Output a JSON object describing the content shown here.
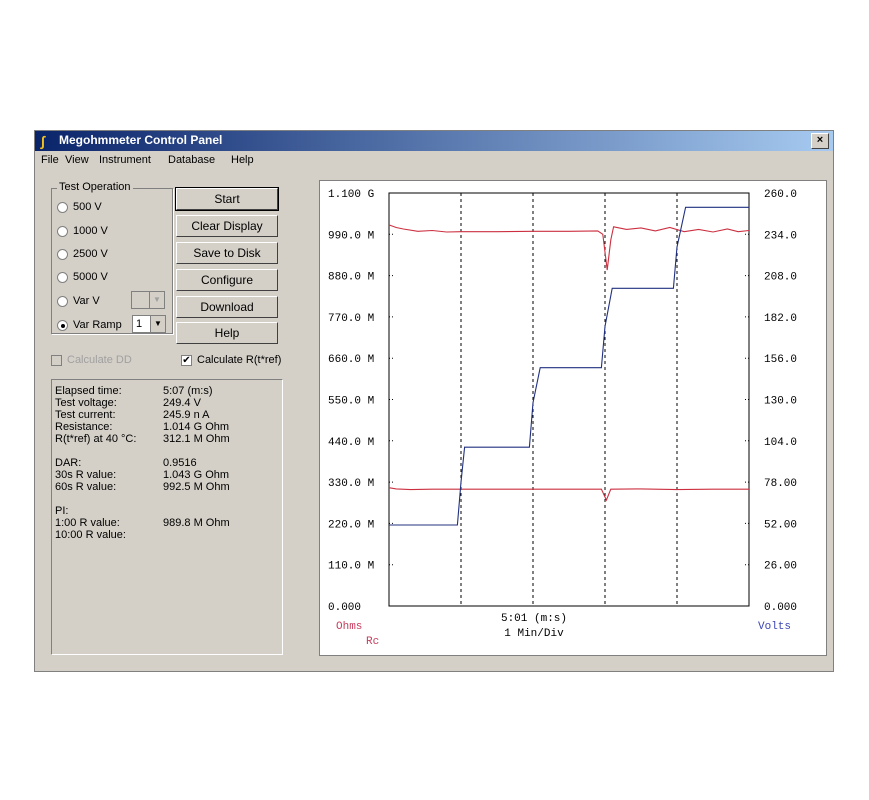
{
  "window": {
    "title": "Megohmmeter Control Panel",
    "close_label": "×"
  },
  "menu": [
    "File",
    "View",
    "Instrument",
    "Database",
    "Help"
  ],
  "test_operation": {
    "label": "Test Operation",
    "options": [
      "500 V",
      "1000 V",
      "2500 V",
      "5000 V",
      "Var V",
      "Var Ramp"
    ],
    "selected": "Var Ramp",
    "var_ramp_value": "1"
  },
  "buttons": [
    "Start",
    "Clear Display",
    "Save to Disk",
    "Configure",
    "Download",
    "Help"
  ],
  "checks": {
    "calc_dd": {
      "label": "Calculate DD",
      "checked": false,
      "enabled": false
    },
    "calc_r": {
      "label": "Calculate R(t*ref)",
      "checked": true,
      "enabled": true
    }
  },
  "status": [
    {
      "label": "Elapsed time:",
      "value": "5:07 (m:s)"
    },
    {
      "label": "Test voltage:",
      "value": "249.4  V"
    },
    {
      "label": "Test current:",
      "value": "245.9 n A"
    },
    {
      "label": "Resistance:",
      "value": "1.014 G Ohm"
    },
    {
      "label": "R(t*ref) at 40 °C:",
      "value": "312.1 M Ohm"
    },
    {
      "label": "",
      "value": ""
    },
    {
      "label": "DAR:",
      "value": "0.9516"
    },
    {
      "label": "30s R value:",
      "value": "1.043 G Ohm"
    },
    {
      "label": "60s R value:",
      "value": "992.5 M Ohm"
    },
    {
      "label": "",
      "value": ""
    },
    {
      "label": "PI:",
      "value": ""
    },
    {
      "label": "1:00 R value:",
      "value": "989.8 M Ohm"
    },
    {
      "label": "10:00 R value:",
      "value": ""
    }
  ],
  "chart_data": {
    "type": "line",
    "x_center_label": "5:01 (m:s)",
    "x_div_label": "1 Min/Div",
    "left_axis_label": "Ohms",
    "left_axis_sublabel": "Rc",
    "right_axis_label": "Volts",
    "left_ticks": [
      "1.100 G",
      "990.0 M",
      "880.0 M",
      "770.0 M",
      "660.0 M",
      "550.0 M",
      "440.0 M",
      "330.0 M",
      "220.0 M",
      "110.0 M",
      "0.000"
    ],
    "right_ticks": [
      "260.0",
      "234.0",
      "208.0",
      "182.0",
      "156.0",
      "130.0",
      "104.0",
      "78.00",
      "52.00",
      "26.00",
      "0.000"
    ],
    "left_range": [
      0,
      1100000000
    ],
    "right_range": [
      0,
      260
    ],
    "x_range": [
      0,
      5
    ],
    "vertical_grid_x": [
      1,
      2,
      3,
      4
    ],
    "colors": {
      "resistance": "#cc3040",
      "rc": "#cc3040",
      "voltage": "#203080",
      "left_label": "#c83c5c",
      "right_label": "#3c46b4"
    },
    "series": [
      {
        "name": "Ohms",
        "points": [
          [
            0,
            1015000000
          ],
          [
            0.1,
            1008000000
          ],
          [
            0.2,
            1004000000
          ],
          [
            0.4,
            998000000
          ],
          [
            0.6,
            1000000000
          ],
          [
            0.8,
            996000000
          ],
          [
            1.0,
            997000000
          ],
          [
            1.5,
            997000000
          ],
          [
            2.0,
            998000000
          ],
          [
            2.5,
            998000000
          ],
          [
            2.9,
            999000000
          ],
          [
            2.97,
            990000000
          ],
          [
            3.03,
            895000000
          ],
          [
            3.08,
            975000000
          ],
          [
            3.12,
            1010000000
          ],
          [
            3.3,
            1003000000
          ],
          [
            3.5,
            1007000000
          ],
          [
            3.7,
            999000000
          ],
          [
            3.9,
            1008000000
          ],
          [
            4.1,
            997000000
          ],
          [
            4.3,
            1003000000
          ],
          [
            4.5,
            996000000
          ],
          [
            4.7,
            1004000000
          ],
          [
            4.85,
            997000000
          ],
          [
            5.0,
            1000000000
          ]
        ]
      },
      {
        "name": "Rc",
        "points": [
          [
            0,
            315000000
          ],
          [
            0.1,
            312000000
          ],
          [
            0.3,
            310000000
          ],
          [
            0.6,
            311000000
          ],
          [
            1.0,
            311000000
          ],
          [
            2.0,
            311000000
          ],
          [
            2.95,
            311000000
          ],
          [
            3.02,
            282000000
          ],
          [
            3.08,
            311000000
          ],
          [
            3.5,
            312000000
          ],
          [
            4.0,
            310000000
          ],
          [
            4.5,
            311000000
          ],
          [
            5.0,
            311000000
          ]
        ]
      },
      {
        "name": "Volts",
        "points": [
          [
            0,
            51
          ],
          [
            0.95,
            51
          ],
          [
            1.0,
            78
          ],
          [
            1.05,
            100
          ],
          [
            1.95,
            100
          ],
          [
            2.0,
            128
          ],
          [
            2.1,
            150
          ],
          [
            2.95,
            150
          ],
          [
            3.0,
            176
          ],
          [
            3.1,
            200
          ],
          [
            3.95,
            200
          ],
          [
            4.0,
            226
          ],
          [
            4.12,
            251
          ],
          [
            5.0,
            251
          ]
        ]
      }
    ]
  }
}
